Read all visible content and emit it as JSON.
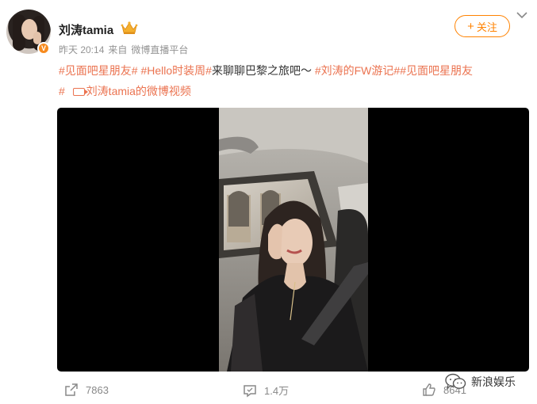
{
  "user": {
    "name": "刘涛tamia",
    "verified_badge": "V",
    "avatar": "avatar-photo"
  },
  "meta": {
    "time": "昨天 20:14",
    "source_prefix": "来自",
    "source": "微博直播平台"
  },
  "follow_button": {
    "icon": "plus-icon",
    "label": "关注"
  },
  "post": {
    "tag1": "#见面吧星朋友#",
    "tag2": "#Hello时装周#",
    "text1": "来聊聊巴黎之旅吧～",
    "tag3": "#刘涛的FW游记#",
    "tag4": "#见面吧星朋友",
    "tag4_end": "#",
    "video_link": "刘涛tamia的微博视频"
  },
  "actions": {
    "repost": {
      "icon": "share-icon",
      "count": "7863"
    },
    "comment": {
      "icon": "comment-icon",
      "count": "1.4万"
    },
    "like": {
      "icon": "thumbs-up-icon",
      "count": "8641"
    }
  },
  "watermark": {
    "text": "新浪娱乐",
    "icon": "wechat-icon"
  },
  "colors": {
    "accent": "#ff8200",
    "tag": "#eb7350",
    "meta": "#939393"
  }
}
